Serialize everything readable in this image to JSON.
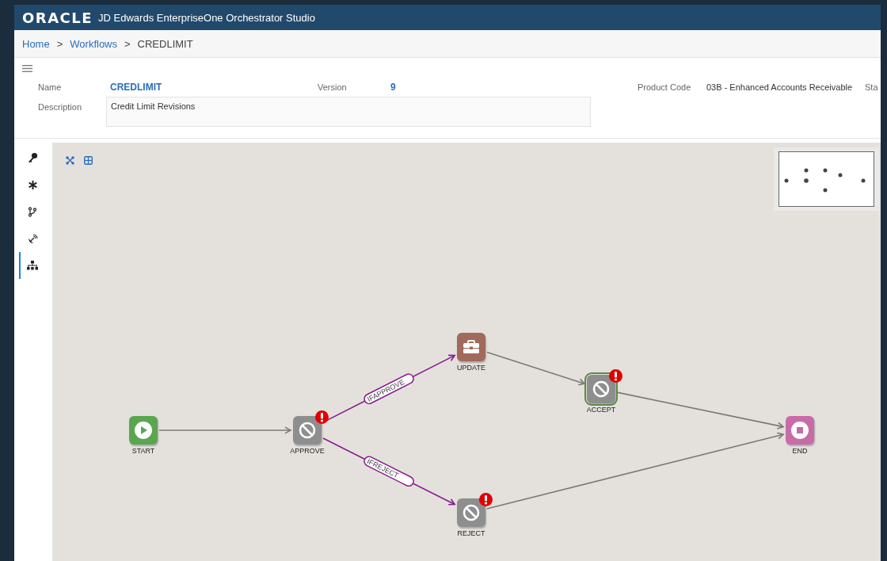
{
  "header": {
    "logo": "ORACLE",
    "title": "JD Edwards EnterpriseOne Orchestrator Studio"
  },
  "breadcrumb": [
    {
      "label": "Home",
      "kind": "link"
    },
    {
      "separator": ">",
      "label": "Workflows",
      "kind": "link"
    },
    {
      "separator": ">",
      "label": "CREDLIMIT",
      "kind": "current"
    }
  ],
  "form": {
    "name_label": "Name",
    "name": "CREDLIMIT",
    "version_label": "Version",
    "version": "9",
    "product_code_label": "Product Code",
    "product_code": "03B - Enhanced Accounts Receivable",
    "column_4_label": "Sta",
    "description_label": "Description",
    "description": "Credit Limit Revisions"
  },
  "rail": [
    {
      "selected": false
    },
    {
      "selected": false
    },
    {
      "selected": false
    },
    {
      "selected": false
    },
    {
      "selected": true
    }
  ],
  "nodes": [
    {
      "label": "START",
      "kind": "start",
      "error": false,
      "selected": false
    },
    {
      "label": "APPROVE",
      "kind": "blocked",
      "error": true,
      "selected": false
    },
    {
      "label": "UPDATE",
      "kind": "task",
      "error": false,
      "selected": false
    },
    {
      "label": "REJECT",
      "kind": "blocked",
      "error": true,
      "selected": false
    },
    {
      "label": "ACCEPT",
      "kind": "blocked",
      "error": true,
      "selected": true
    },
    {
      "label": "END",
      "kind": "end",
      "error": false,
      "selected": false
    }
  ],
  "connections": [
    {
      "kind": "flow"
    },
    {
      "kind": "condition",
      "label": "IFAPPROVE"
    },
    {
      "kind": "condition",
      "label": "IFREJECT"
    },
    {
      "kind": "flow"
    },
    {
      "kind": "flow"
    },
    {
      "kind": "flow"
    }
  ]
}
